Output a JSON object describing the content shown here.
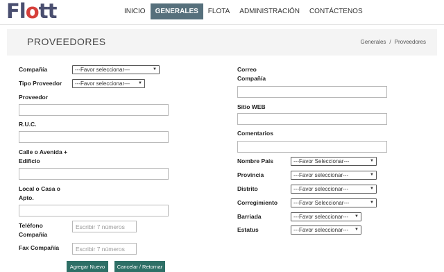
{
  "header": {
    "logo_text": "Flott",
    "nav": [
      "INICIO",
      "GENERALES",
      "FLOTA",
      "ADMINISTRACIÓN",
      "CONTÁCTENOS"
    ],
    "active_nav": "GENERALES"
  },
  "titlebar": {
    "title": "PROVEEDORES",
    "breadcrumb": [
      "Generales",
      "Proveedores"
    ],
    "breadcrumb_sep": "/"
  },
  "form": {
    "compania_label": "Compañía",
    "compania_select": "---Favor seleccionar---",
    "tipo_label": "Tipo Proveedor",
    "tipo_select": "---Favor seleccionar---",
    "proveedor_label": "Proveedor",
    "ruc_label": "R.U.C.",
    "calle_label_1": "Calle o Avenida +",
    "calle_label_2": "Edificio",
    "local_label_1": "Local o Casa o",
    "local_label_2": "Apto.",
    "telefono_label_1": "Teléfono",
    "telefono_label_2": "Compañía",
    "telefono_placeholder": "Escribir 7 números",
    "fax_label": "Fax Compañía",
    "fax_placeholder": "Escribir 7 números",
    "correo_label_1": "Correo",
    "correo_label_2": "Compañía",
    "sitio_label": "Sitio WEB",
    "comentarios_label": "Comentarios",
    "pais_label": "Nombre País",
    "pais_select": "---Favor Seleccionar---",
    "provincia_label": "Provincia",
    "provincia_select": "---Favor seleccionar---",
    "distrito_label": "Distrito",
    "distrito_select": "---Favor seleccionar---",
    "corregimiento_label": "Corregimiento",
    "corregimiento_select": "---Favor Seleccionar---",
    "barriada_label": "Barriada",
    "barriada_select": "---Favor seleccionar---",
    "estatus_label": "Estatus",
    "estatus_select": "---Favor seleccionar---"
  },
  "buttons": {
    "add": "Agregar Nuevo",
    "cancel": "Cancelar / Retornar"
  },
  "colors": {
    "active_nav_bg": "#56707c",
    "button_bg": "#2e6f66",
    "logo_primary": "#4a4f70",
    "logo_accent": "#d6403b"
  }
}
